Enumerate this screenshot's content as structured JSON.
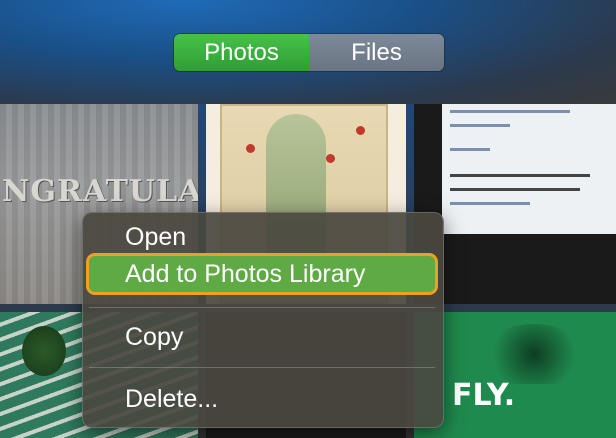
{
  "tabs": {
    "photos_label": "Photos",
    "files_label": "Files",
    "active": "Photos"
  },
  "tiles": {
    "sign_text": "NGRATULATIC",
    "fly_text": "FLY."
  },
  "context_menu": {
    "open_label": "Open",
    "add_label": "Add to Photos Library",
    "copy_label": "Copy",
    "delete_label": "Delete...",
    "highlighted_item": "Add to Photos Library"
  },
  "colors": {
    "active_tab": "#3cb53f",
    "highlight_fill": "#5faa45",
    "highlight_ring": "#f0a021",
    "menu_bg": "#4a4840"
  }
}
